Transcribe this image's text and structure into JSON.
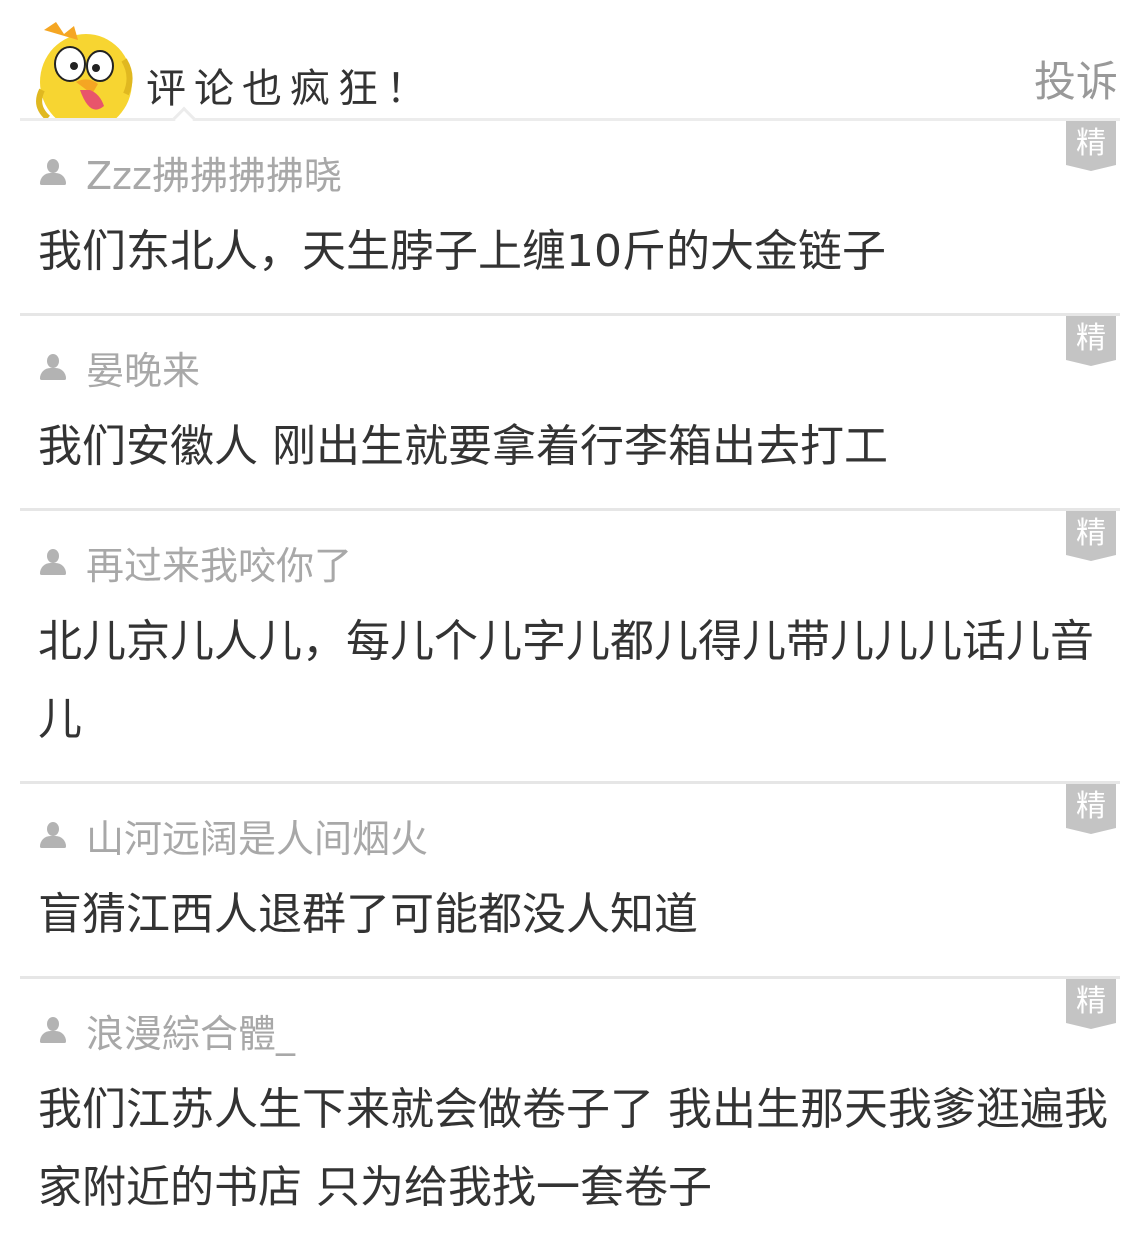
{
  "header": {
    "title": "评论也疯狂！",
    "report_label": "投诉",
    "mascot_icon": "yellow-chick-mascot-icon"
  },
  "badge_label": "精",
  "comments": [
    {
      "username": "Zzz拂拂拂拂晓",
      "text": "我们东北人，天生脖子上缠10斤的大金链子"
    },
    {
      "username": "晏晚来",
      "text": "我们安徽人 刚出生就要拿着行李箱出去打工"
    },
    {
      "username": "再过来我咬你了",
      "text": "北儿京儿人儿，每儿个儿字儿都儿得儿带儿儿儿话儿音儿"
    },
    {
      "username": "山河远阔是人间烟火",
      "text": "盲猜江西人退群了可能都没人知道"
    },
    {
      "username": "浪漫綜合體_",
      "text": "我们江苏人生下来就会做卷子了 我出生那天我爹逛遍我家附近的书店 只为给我找一套卷子"
    }
  ],
  "colors": {
    "badge_bg": "#c4c4c4",
    "username": "#a8a8a8",
    "text": "#333333",
    "report": "#999999",
    "mascot": "#f7d531"
  }
}
